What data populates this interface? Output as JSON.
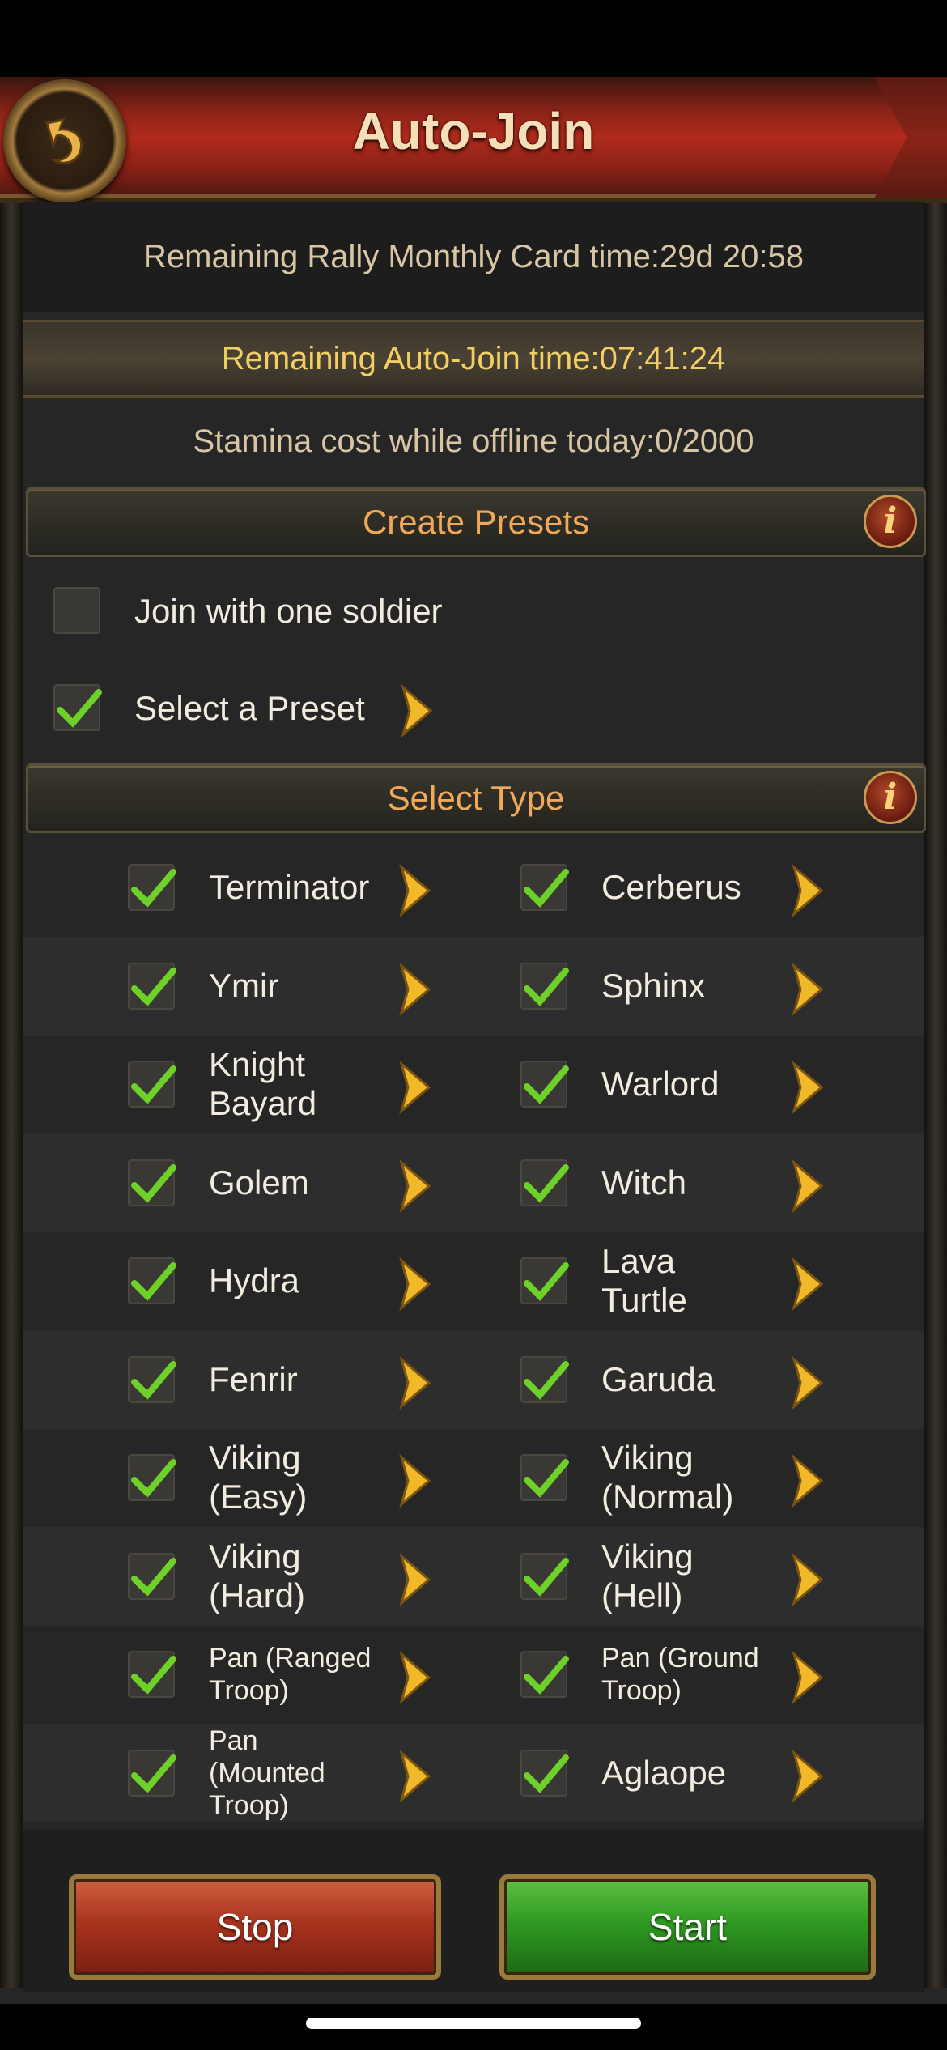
{
  "header": {
    "title": "Auto-Join"
  },
  "status": {
    "monthly_card": "Remaining Rally Monthly Card time:29d 20:58",
    "auto_join_time": "Remaining Auto-Join time:07:41:24",
    "stamina": "Stamina cost while offline today:0/2000"
  },
  "presets": {
    "section_title": "Create Presets",
    "info_icon": "i",
    "join_one_soldier": {
      "label": "Join with one soldier",
      "checked": false
    },
    "select_preset": {
      "label": "Select a Preset",
      "checked": true
    }
  },
  "types": {
    "section_title": "Select Type",
    "info_icon": "i",
    "rows": [
      {
        "left": {
          "label": "Terminator",
          "checked": true
        },
        "right": {
          "label": "Cerberus",
          "checked": true
        }
      },
      {
        "left": {
          "label": "Ymir",
          "checked": true
        },
        "right": {
          "label": "Sphinx",
          "checked": true
        }
      },
      {
        "left": {
          "label": "Knight\nBayard",
          "checked": true
        },
        "right": {
          "label": "Warlord",
          "checked": true
        }
      },
      {
        "left": {
          "label": "Golem",
          "checked": true
        },
        "right": {
          "label": "Witch",
          "checked": true
        }
      },
      {
        "left": {
          "label": "Hydra",
          "checked": true
        },
        "right": {
          "label": "Lava\nTurtle",
          "checked": true
        }
      },
      {
        "left": {
          "label": "Fenrir",
          "checked": true
        },
        "right": {
          "label": "Garuda",
          "checked": true
        }
      },
      {
        "left": {
          "label": "Viking\n(Easy)",
          "checked": true
        },
        "right": {
          "label": "Viking\n(Normal)",
          "checked": true
        }
      },
      {
        "left": {
          "label": "Viking\n(Hard)",
          "checked": true
        },
        "right": {
          "label": "Viking\n(Hell)",
          "checked": true
        }
      },
      {
        "left": {
          "label": "Pan (Ranged\nTroop)",
          "checked": true
        },
        "right": {
          "label": "Pan (Ground\nTroop)",
          "checked": true
        }
      },
      {
        "left": {
          "label": "Pan\n(Mounted\nTroop)",
          "checked": true
        },
        "right": {
          "label": "Aglaope",
          "checked": true
        }
      }
    ]
  },
  "actions": {
    "stop_label": "Stop",
    "start_label": "Start"
  },
  "colors": {
    "accent_gold": "#f3cf63",
    "section_orange": "#f0a95a",
    "stop_red": "#a8341e",
    "start_green": "#2f9a22"
  },
  "icons": {
    "back": "back-arrow-icon",
    "check": "check-icon",
    "arrow": "chevron-right-icon",
    "info": "info-icon"
  }
}
